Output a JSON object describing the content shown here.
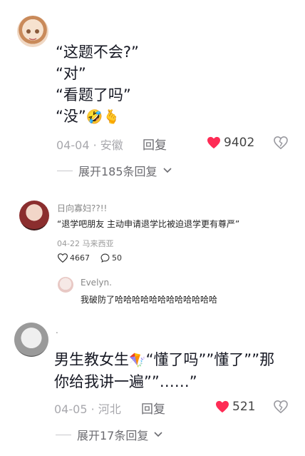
{
  "comment1": {
    "lines": [
      "“这题不会?”",
      "“对”",
      "“看题了吗”",
      "“没”"
    ],
    "emojis": [
      "🤣",
      "🫰"
    ],
    "date": "04-04",
    "location": "安徽",
    "reply_label": "回复",
    "likes": "9402",
    "expand_label": "展开185条回复"
  },
  "comment2": {
    "username": "日向寡妇??!!",
    "text": "“退学吧朋友 主动申请退学比被迫退学更有尊严”",
    "date": "04-22",
    "location": "马来西亚",
    "likes": "4667",
    "comments": "50",
    "reply": {
      "username": "Evelyn.",
      "text": "我破防了哈哈哈哈哈哈哈哈哈哈哈哈"
    }
  },
  "comment3": {
    "username": ".",
    "text_part1": "男生教女生",
    "text_part2": "“懂了吗””懂了””那",
    "text_line2": "你给我讲一遍””……”",
    "emoji": "🪁",
    "date": "04-05",
    "location": "河北",
    "reply_label": "回复",
    "likes": "521",
    "expand_label": "展开17条回复"
  },
  "colors": {
    "heart_red": "#fe2c55",
    "muted": "#a8a8ad"
  }
}
